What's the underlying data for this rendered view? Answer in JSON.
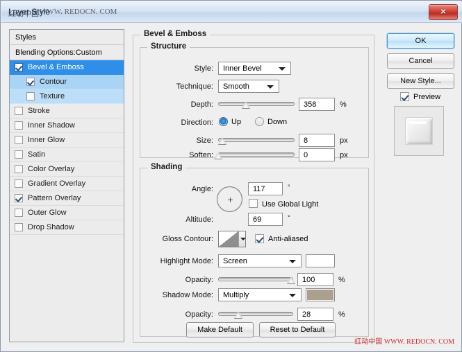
{
  "window": {
    "title": "Layer Style",
    "watermark_overlay_latin": "WWW. REDOCN. COM",
    "watermark_overlay_cn": "红动中国",
    "close_icon": "×"
  },
  "styles_panel": {
    "header": "Styles",
    "blending_options": "Blending Options:Custom",
    "effects": [
      {
        "label": "Bevel & Emboss",
        "checked": true,
        "selected": true,
        "indent": 0
      },
      {
        "label": "Contour",
        "checked": true,
        "selected": false,
        "indent": 1
      },
      {
        "label": "Texture",
        "checked": false,
        "selected": false,
        "indent": 1
      },
      {
        "label": "Stroke",
        "checked": false,
        "selected": false,
        "indent": 0
      },
      {
        "label": "Inner Shadow",
        "checked": false,
        "selected": false,
        "indent": 0
      },
      {
        "label": "Inner Glow",
        "checked": false,
        "selected": false,
        "indent": 0
      },
      {
        "label": "Satin",
        "checked": false,
        "selected": false,
        "indent": 0
      },
      {
        "label": "Color Overlay",
        "checked": false,
        "selected": false,
        "indent": 0
      },
      {
        "label": "Gradient Overlay",
        "checked": false,
        "selected": false,
        "indent": 0
      },
      {
        "label": "Pattern Overlay",
        "checked": true,
        "selected": false,
        "indent": 0
      },
      {
        "label": "Outer Glow",
        "checked": false,
        "selected": false,
        "indent": 0
      },
      {
        "label": "Drop Shadow",
        "checked": false,
        "selected": false,
        "indent": 0
      }
    ]
  },
  "main": {
    "section_title": "Bevel & Emboss",
    "structure": {
      "title": "Structure",
      "style_label": "Style:",
      "style_value": "Inner Bevel",
      "technique_label": "Technique:",
      "technique_value": "Smooth",
      "depth_label": "Depth:",
      "depth_value": "358",
      "depth_unit": "%",
      "depth_percent": 36,
      "direction_label": "Direction:",
      "direction_up": "Up",
      "direction_down": "Down",
      "direction_selected": "Up",
      "size_label": "Size:",
      "size_value": "8",
      "size_unit": "px",
      "size_percent": 5,
      "soften_label": "Soften:",
      "soften_value": "0",
      "soften_unit": "px",
      "soften_percent": 0
    },
    "shading": {
      "title": "Shading",
      "angle_label": "Angle:",
      "angle_value": "117",
      "angle_unit": "°",
      "use_global_light": "Use Global Light",
      "use_global_light_checked": false,
      "altitude_label": "Altitude:",
      "altitude_value": "69",
      "altitude_unit": "°",
      "gloss_contour_label": "Gloss Contour:",
      "anti_aliased": "Anti-aliased",
      "anti_aliased_checked": true,
      "highlight_mode_label": "Highlight Mode:",
      "highlight_mode_value": "Screen",
      "highlight_color": "#ffffff",
      "highlight_opacity_label": "Opacity:",
      "highlight_opacity_value": "100",
      "highlight_opacity_unit": "%",
      "highlight_opacity_percent": 97,
      "shadow_mode_label": "Shadow Mode:",
      "shadow_mode_value": "Multiply",
      "shadow_color": "#ab9f8d",
      "shadow_opacity_label": "Opacity:",
      "shadow_opacity_value": "28",
      "shadow_opacity_unit": "%",
      "shadow_opacity_percent": 27
    }
  },
  "buttons": {
    "ok": "OK",
    "cancel": "Cancel",
    "new_style": "New Style...",
    "preview": "Preview",
    "preview_checked": true,
    "make_default": "Make Default",
    "reset_to_default": "Reset to Default"
  },
  "footer": {
    "watermark_cn": "红动中国",
    "watermark_url": "WWW. REDOCN. COM",
    "watermark_color": "#c8312b"
  }
}
